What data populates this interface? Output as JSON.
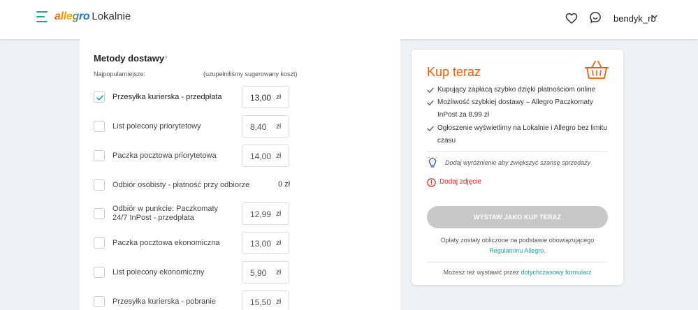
{
  "header": {
    "logo_brand": "allegro",
    "logo_suffix": "Lokalnie",
    "username": "bendyk_rb",
    "icons": [
      "menu-icon",
      "heart-icon",
      "chat-icon",
      "chevron-down-icon"
    ]
  },
  "delivery": {
    "title": "Metody dostawy",
    "required_mark": "*",
    "popular_label": "Najpopularniejsze:",
    "suggested_note": "(uzupełniliśmy sugerowany koszt)",
    "items": [
      {
        "label": "Przesyłka kurierska - przedpłata",
        "price": "13,00",
        "currency": "zł",
        "checked": true
      },
      {
        "label": "List polecony priorytetowy",
        "price": "8,40",
        "currency": "zł",
        "checked": false
      },
      {
        "label": "Paczka pocztowa priorytetowa",
        "price": "14,00",
        "currency": "zł",
        "checked": false
      },
      {
        "label": "Odbiór osobisty - płatność przy odbiorze",
        "price": "0 zł",
        "checked": false
      },
      {
        "label": "Odbiór w punkcie: Paczkomaty 24/7 InPost - przedpłata",
        "price": "12,99",
        "currency": "zł",
        "checked": false
      },
      {
        "label": "Paczka pocztowa ekonomiczna",
        "price": "13,00",
        "currency": "zł",
        "checked": false
      },
      {
        "label": "List polecony ekonomiczny",
        "price": "5,90",
        "currency": "zł",
        "checked": false
      },
      {
        "label": "Przesyłka kurierska - pobranie",
        "price": "15,50",
        "currency": "zł",
        "checked": false
      }
    ]
  },
  "buy_now": {
    "title": "Kup teraz",
    "bullets": [
      "Kupujący zapłacą szybko dzięki płatnościom online",
      "Możliwość szybkiej dostawy – Allegro Paczkomaty InPost za 8,99 zł",
      "Ogłoszenie wyświetlimy na Lokalnie i Allegro bez limitu czasu"
    ],
    "hint": "Dodaj wyróżnienie aby zwiększyć szansę sprzedaży",
    "error": "Dodaj zdjęcie",
    "button": "WYSTAW JAKO KUP TERAZ",
    "fee_text": "Opłaty zostały obliczone na podstawie obowiązującego",
    "fee_link": "Regulaminu Allegro.",
    "alt_text": "Możesz też wystawić przez",
    "alt_link": "dotychczasowy formularz"
  },
  "colors": {
    "accent": "#1fa39b",
    "orange": "#ff5a00",
    "error": "#e0241b",
    "disabled_button": "#c8c8c8"
  }
}
